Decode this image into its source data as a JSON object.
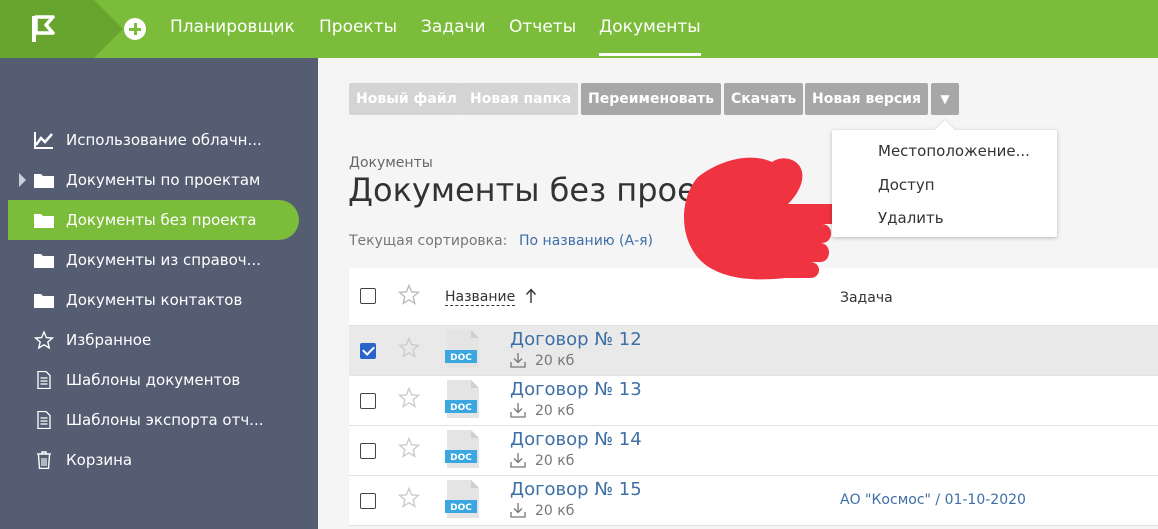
{
  "nav": {
    "items": [
      "Планировщик",
      "Проекты",
      "Задачи",
      "Отчеты",
      "Документы"
    ],
    "active_index": 4
  },
  "sidebar": {
    "items": [
      {
        "label": "Использование облачн...",
        "icon": "chart-icon"
      },
      {
        "label": "Документы по проектам",
        "icon": "folder-icon"
      },
      {
        "label": "Документы без проекта",
        "icon": "folder-icon"
      },
      {
        "label": "Документы из справоч...",
        "icon": "folder-icon"
      },
      {
        "label": "Документы контактов",
        "icon": "folder-icon"
      },
      {
        "label": "Избранное",
        "icon": "star-icon"
      },
      {
        "label": "Шаблоны документов",
        "icon": "document-icon"
      },
      {
        "label": "Шаблоны экспорта отч...",
        "icon": "document-icon"
      },
      {
        "label": "Корзина",
        "icon": "trash-icon"
      }
    ],
    "active_index": 2
  },
  "toolbar": {
    "new_file": "Новый файл",
    "new_folder": "Новая папка",
    "rename": "Переименовать",
    "download": "Скачать",
    "new_version": "Новая версия",
    "more": "▼"
  },
  "dropdown": {
    "items": [
      "Местоположение...",
      "Доступ",
      "Удалить"
    ]
  },
  "breadcrumb": "Документы",
  "page_title": "Документы без проекта",
  "sort": {
    "label": "Текущая сортировка:",
    "value": "По названию (А-я)"
  },
  "table": {
    "columns": {
      "name": "Название",
      "task": "Задача"
    },
    "rows": [
      {
        "name": "Договор № 12",
        "size": "20 кб",
        "task": "",
        "checked": true
      },
      {
        "name": "Договор № 13",
        "size": "20 кб",
        "task": "",
        "checked": false
      },
      {
        "name": "Договор № 14",
        "size": "20 кб",
        "task": "",
        "checked": false
      },
      {
        "name": "Договор № 15",
        "size": "20 кб",
        "task": "АО \"Космос\" / 01-10-2020",
        "checked": false
      }
    ]
  },
  "colors": {
    "brand_green": "#7bbd3a",
    "sidebar_bg": "#555d72",
    "link_blue": "#3e6fa6",
    "hand_red": "#ef3340"
  }
}
